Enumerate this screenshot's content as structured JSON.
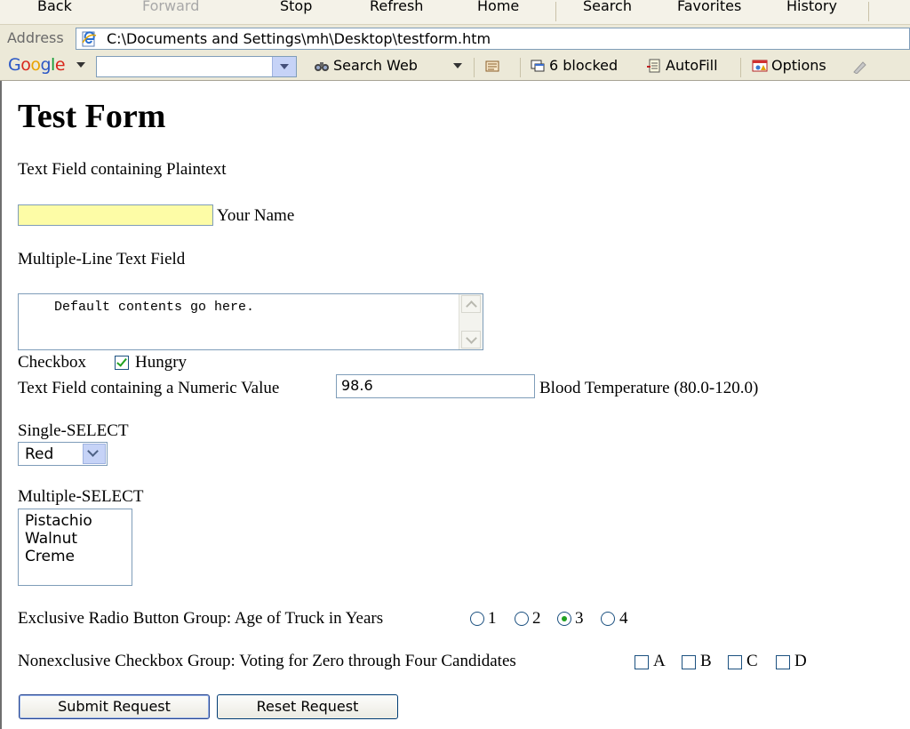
{
  "nav_toolbar": {
    "back": "Back",
    "forward": "Forward",
    "stop": "Stop",
    "refresh": "Refresh",
    "home": "Home",
    "search": "Search",
    "favorites": "Favorites",
    "history": "History"
  },
  "address_bar": {
    "label": "Address",
    "url": "C:\\Documents and Settings\\mh\\Desktop\\testform.htm"
  },
  "google_toolbar": {
    "logo": "Google",
    "search_value": "",
    "search_web": "Search Web",
    "popups_blocked": "6 blocked",
    "autofill": "AutoFill",
    "options": "Options"
  },
  "page": {
    "title": "Test Form",
    "plaintext_section": "Text Field containing Plaintext",
    "name_value": "",
    "name_label": "Your Name",
    "multiline_section": "Multiple-Line Text Field",
    "textarea_value": "Default contents go here.",
    "checkbox_section": "Checkbox",
    "checkbox_label": "Hungry",
    "checkbox_checked": true,
    "numeric_section": "Text Field containing a Numeric Value",
    "temperature_value": "98.6",
    "temperature_label": "Blood Temperature (80.0-120.0)",
    "single_select_section": "Single-SELECT",
    "single_select_value": "Red",
    "multi_select_section": "Multiple-SELECT",
    "multi_select_options": [
      "Pistachio",
      "Walnut",
      "Creme"
    ],
    "radio_section": "Exclusive Radio Button Group: Age of Truck in Years",
    "radio_options": [
      "1",
      "2",
      "3",
      "4"
    ],
    "radio_selected": "3",
    "checkbox_group_section": "Nonexclusive Checkbox Group: Voting for Zero through Four Candidates",
    "checkbox_group_options": [
      "A",
      "B",
      "C",
      "D"
    ],
    "submit_label": "Submit Request",
    "reset_label": "Reset Request"
  },
  "colors": {
    "name_field_bg": "#fdfca6",
    "check_mark": "#21a121",
    "control_border": "#7f9db9"
  }
}
